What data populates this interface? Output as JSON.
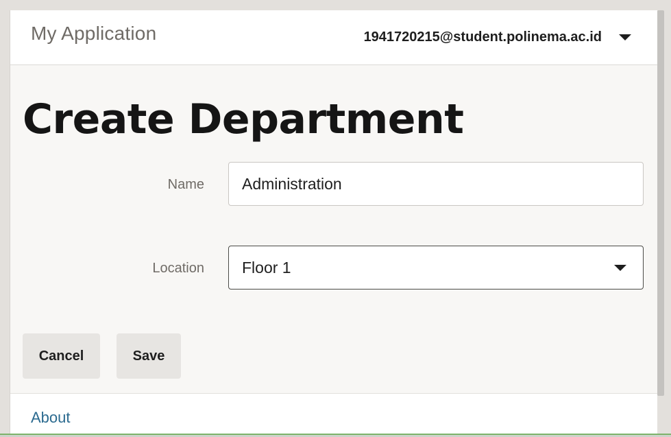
{
  "header": {
    "app_title": "My Application",
    "user_email": "1941720215@student.polinema.ac.id"
  },
  "page": {
    "title": "Create Department"
  },
  "form": {
    "name_label": "Name",
    "name_value": "Administration",
    "location_label": "Location",
    "location_value": "Floor 1"
  },
  "actions": {
    "cancel_label": "Cancel",
    "save_label": "Save"
  },
  "footer": {
    "about_label": "About"
  },
  "icons": {
    "user_menu": "chevron-down-icon",
    "select": "chevron-down-icon"
  },
  "colors": {
    "link": "#2b6a8f",
    "button_bg": "#e7e5e2",
    "page_bg": "#f8f7f5"
  }
}
